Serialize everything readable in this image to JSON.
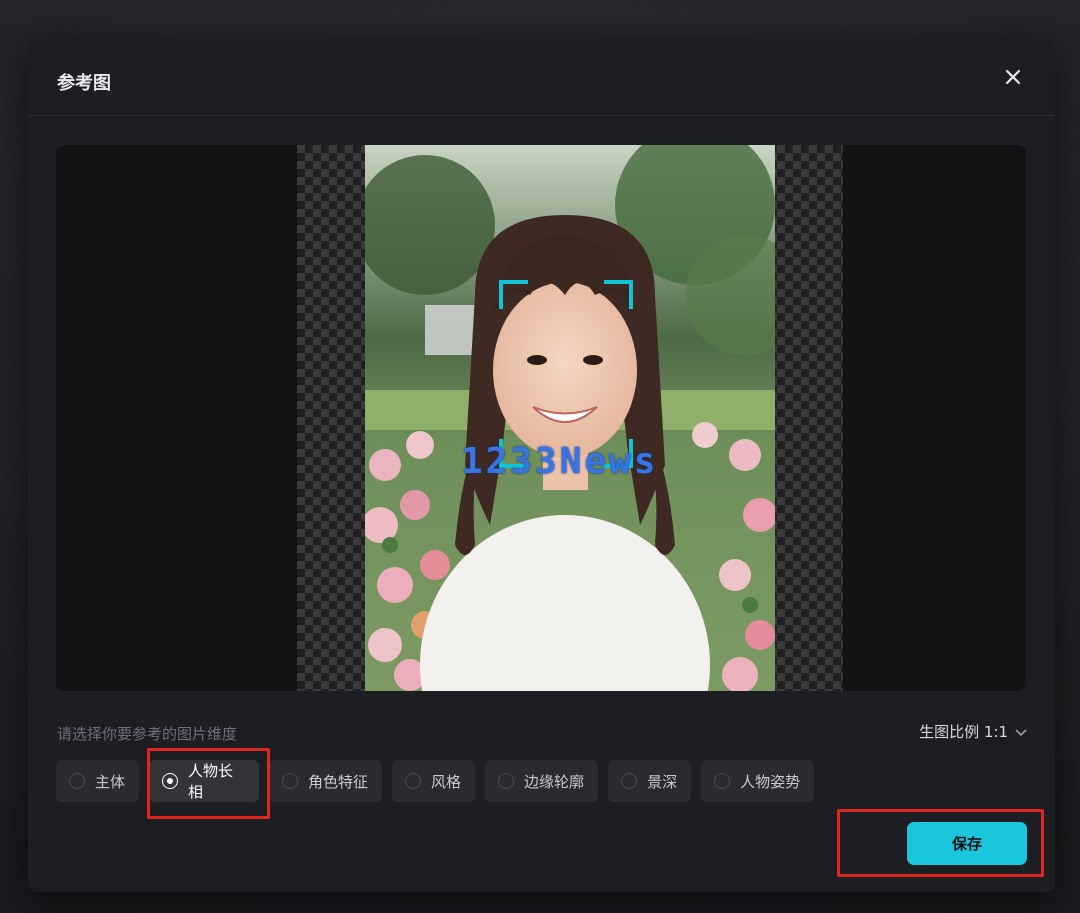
{
  "dialog": {
    "title": "参考图",
    "close_icon": "close-icon"
  },
  "preview": {
    "watermark": "1233News",
    "face_bracket_icon": "face-detect-bracket-icon",
    "thumbnail_icon": "face-thumbnail-image"
  },
  "dimension": {
    "label": "请选择你要参考的图片维度",
    "ratio_label": "生图比例 1:1",
    "ratio_icon": "chevron-down-icon"
  },
  "options": [
    {
      "label": "主体",
      "selected": false
    },
    {
      "label": "人物长相",
      "selected": true
    },
    {
      "label": "角色特征",
      "selected": false
    },
    {
      "label": "风格",
      "selected": false
    },
    {
      "label": "边缘轮廓",
      "selected": false
    },
    {
      "label": "景深",
      "selected": false
    },
    {
      "label": "人物姿势",
      "selected": false
    }
  ],
  "actions": {
    "save_label": "保存"
  },
  "colors": {
    "accent": "#19c6dc",
    "highlight": "#e0251e",
    "dialog_bg": "#1d1e23"
  }
}
